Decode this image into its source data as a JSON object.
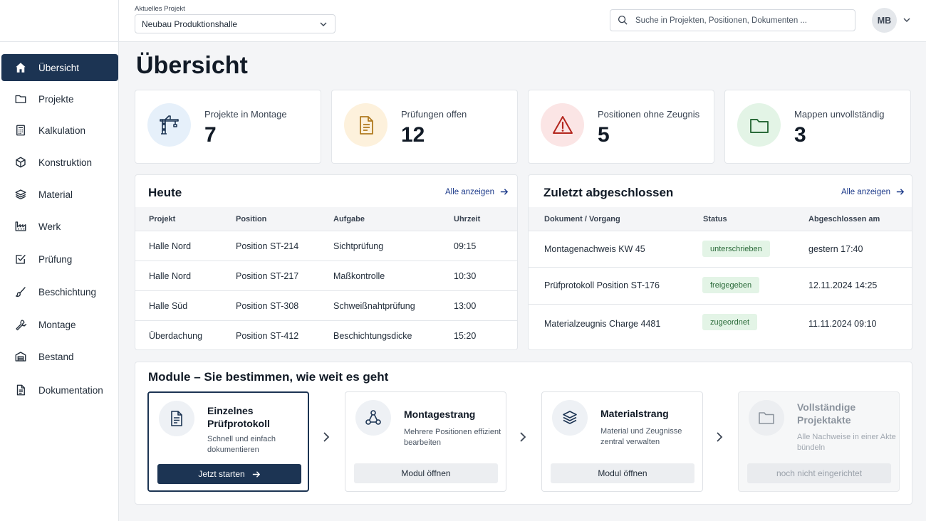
{
  "sidebar": {
    "items": [
      {
        "label": "Übersicht",
        "icon": "home-icon"
      },
      {
        "label": "Projekte",
        "icon": "folder-icon"
      },
      {
        "label": "Kalkulation",
        "icon": "calculator-icon"
      },
      {
        "label": "Konstruktion",
        "icon": "cube-icon"
      },
      {
        "label": "Material",
        "icon": "layers-icon"
      },
      {
        "label": "Werk",
        "icon": "factory-icon"
      },
      {
        "label": "Prüfung",
        "icon": "checkbox-icon"
      },
      {
        "label": "Beschichtung",
        "icon": "brush-icon"
      },
      {
        "label": "Montage",
        "icon": "wrench-icon"
      },
      {
        "label": "Bestand",
        "icon": "warehouse-icon"
      },
      {
        "label": "Dokumentation",
        "icon": "document-icon"
      }
    ]
  },
  "topbar": {
    "project_label": "Aktuelles Projekt",
    "project_value": "Neubau Produktionshalle",
    "search_placeholder": "Suche in Projekten, Positionen, Dokumenten ...",
    "avatar_initials": "MB"
  },
  "page": {
    "title": "Übersicht"
  },
  "kpis": [
    {
      "label": "Projekte in Montage",
      "value": "7",
      "icon": "crane-icon",
      "color": "#e6f0fa",
      "icon_color": "#1c3453"
    },
    {
      "label": "Prüfungen offen",
      "value": "12",
      "icon": "document-icon",
      "color": "#fdf1dc",
      "icon_color": "#b07a1f"
    },
    {
      "label": "Positionen ohne Zeugnis",
      "value": "5",
      "icon": "warning-icon",
      "color": "#fbe5e5",
      "icon_color": "#b3261e"
    },
    {
      "label": "Mappen unvollständig",
      "value": "3",
      "icon": "folder-icon",
      "color": "#e3f4e6",
      "icon_color": "#2b6b3a"
    }
  ],
  "today": {
    "title": "Heute",
    "link": "Alle anzeigen",
    "columns": [
      "Projekt",
      "Position",
      "Aufgabe",
      "Uhrzeit"
    ],
    "rows": [
      [
        "Halle Nord",
        "Position ST-214",
        "Sichtprüfung",
        "09:15"
      ],
      [
        "Halle Nord",
        "Position ST-217",
        "Maßkontrolle",
        "10:30"
      ],
      [
        "Halle Süd",
        "Position ST-308",
        "Schweißnahtprüfung",
        "13:00"
      ],
      [
        "Überdachung",
        "Position ST-412",
        "Beschichtungsdicke",
        "15:20"
      ]
    ]
  },
  "recent": {
    "title": "Zuletzt abgeschlossen",
    "link": "Alle anzeigen",
    "columns": [
      "Dokument / Vorgang",
      "Status",
      "Abgeschlossen am"
    ],
    "rows": [
      [
        "Montagenachweis KW 45",
        "unterschrieben",
        "gestern 17:40"
      ],
      [
        "Prüfprotokoll Position ST-176",
        "freigegeben",
        "12.11.2024 14:25"
      ],
      [
        "Materialzeugnis Charge 4481",
        "zugeordnet",
        "11.11.2024 09:10"
      ]
    ]
  },
  "modules": {
    "title": "Module – Sie bestimmen, wie weit es geht",
    "items": [
      {
        "title": "Einzelnes Prüfprotokoll",
        "desc": "Schnell und einfach dokumentieren",
        "button": "Jetzt starten",
        "icon": "document-icon"
      },
      {
        "title": "Montagestrang",
        "desc": "Mehrere Positionen effizient bearbeiten",
        "button": "Modul öffnen",
        "icon": "network-icon"
      },
      {
        "title": "Materialstrang",
        "desc": "Material und Zeugnisse zentral verwalten",
        "button": "Modul öffnen",
        "icon": "layers-icon"
      },
      {
        "title": "Vollständige Projektakte",
        "desc": "Alle Nachweise in einer Akte bündeln",
        "button": "noch nicht eingerichtet",
        "icon": "folder-icon"
      }
    ]
  }
}
